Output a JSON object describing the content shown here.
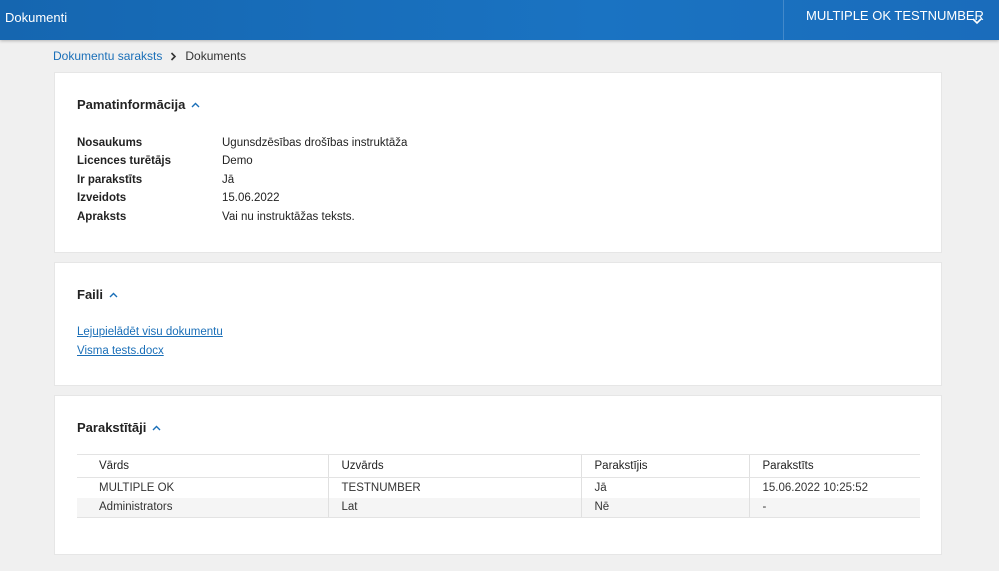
{
  "header": {
    "app_title": "Dokumenti",
    "user_name": "MULTIPLE OK TESTNUMBER"
  },
  "breadcrumb": {
    "parent": "Dokumentu saraksts",
    "current": "Dokuments"
  },
  "basic_info": {
    "title": "Pamatinformācija",
    "rows": [
      {
        "label": "Nosaukums",
        "value": "Ugunsdzēsības drošības instruktāža"
      },
      {
        "label": "Licences turētājs",
        "value": "Demo"
      },
      {
        "label": "Ir parakstīts",
        "value": "Jā"
      },
      {
        "label": "Izveidots",
        "value": "15.06.2022"
      },
      {
        "label": "Apraksts",
        "value": "Vai nu instruktāžas teksts."
      }
    ]
  },
  "files": {
    "title": "Faili",
    "links": [
      "Lejupielādēt visu dokumentu",
      "Visma tests.docx"
    ]
  },
  "signers": {
    "title": "Parakstītāji",
    "columns": [
      "Vārds",
      "Uzvārds",
      "Parakstījis",
      "Parakstīts"
    ],
    "rows": [
      [
        "MULTIPLE OK",
        "TESTNUMBER",
        "Jā",
        "15.06.2022 10:25:52"
      ],
      [
        "Administrators",
        "Lat",
        "Nē",
        "-"
      ]
    ]
  },
  "colors": {
    "header_bg": "#1566b0",
    "link": "#1a6fb8"
  },
  "icons": [
    "chevron-down-icon",
    "chevron-right-icon",
    "chevron-up-icon"
  ]
}
